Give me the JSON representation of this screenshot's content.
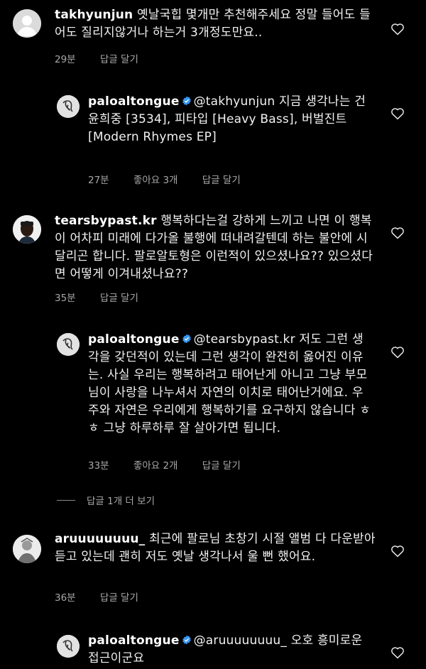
{
  "comments": [
    {
      "username": "takhyunjun",
      "text": "옛날국힙 몇개만 추천해주세요 정말 들어도 들어도 질리지않거나 하는거 3개정도만요..",
      "time": "29분",
      "likes": "",
      "reply": "답글 달기"
    },
    {
      "username": "paloaltongue",
      "verified": true,
      "mention": "@takhyunjun",
      "text": "지금 생각나는 건\n윤희중 [3534], 피타입 [Heavy Bass], 버벌진트 [Modern Rhymes EP]",
      "time": "27분",
      "likes": "좋아요 3개",
      "reply": "답글 달기"
    },
    {
      "username": "tearsbypast.kr",
      "text": "행복하다는걸 강하게 느끼고 나면 이 행복이 어차피 미래에 다가올 불행에 떠내려갈텐데 하는 불안에 시달리곤 합니다. 팔로알토형은 이런적이 있으셨나요?? 있으셨다면 어떻게 이겨내셨나요??",
      "time": "35분",
      "likes": "",
      "reply": "답글 달기"
    },
    {
      "username": "paloaltongue",
      "verified": true,
      "mention": "@tearsbypast.kr",
      "text": "저도 그런 생각을 갖던적이 있는데 그런 생각이 완전히 옳어진 이유는. 사실 우리는 행복하려고 태어난게 아니고 그냥 부모님이 사랑을 나누셔서 자연의 이치로 태어난거에요. 우주와 자연은 우리에게 행복하기를 요구하지 않습니다 ㅎㅎ 그냥 하루하루 잘 살아가면 됩니다.",
      "time": "33분",
      "likes": "좋아요 2개",
      "reply": "답글 달기"
    },
    {
      "username": "aruuuuuuuu_",
      "text": "최근에 팔로님 초창기 시절 앨범 다 다운받아 듣고 있는데 괜히 저도 옛날 생각나서 울 뻔 했어요.",
      "time": "36분",
      "likes": "",
      "reply": "답글 달기"
    },
    {
      "username": "paloaltongue",
      "verified": true,
      "mention": "@aruuuuuuuu_",
      "text": "오호 흥미로운 접근이군요",
      "time": "",
      "likes": "",
      "reply": ""
    }
  ],
  "view_more": "답글 1개 더 보기",
  "colors": {
    "background": "#000000",
    "text": "#f5f5f5",
    "meta": "#a8a8a8",
    "verified": "#3897f0"
  },
  "icons": {
    "like": "heart-icon",
    "verified": "verified-badge-icon"
  }
}
